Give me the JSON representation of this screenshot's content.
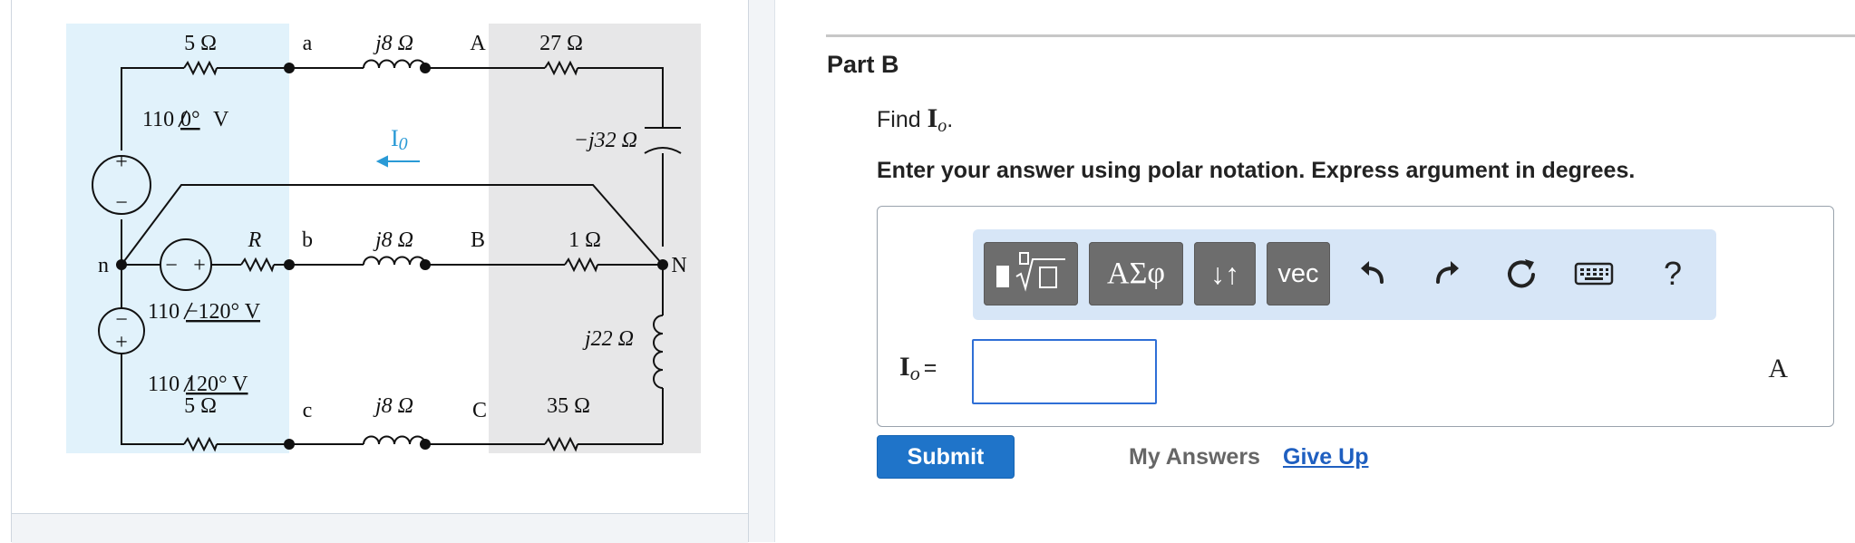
{
  "circuit": {
    "resistor_a": "5 Ω",
    "node_a": "a",
    "inductor_a": "j8 Ω",
    "node_A": "A",
    "resistor_A": "27 Ω",
    "source_a": "110",
    "source_a_angle": "0°",
    "source_a_unit": " V",
    "current_label": "I",
    "current_sub": "0",
    "capacitor": "−j32 Ω",
    "node_n": "n",
    "resistor_R": "R",
    "node_b": "b",
    "inductor_b": "j8 Ω",
    "node_B": "B",
    "resistor_B": "1 Ω",
    "node_N": "N",
    "source_b": "110",
    "source_b_angle": "−120° V",
    "inductor_N": "j22 Ω",
    "source_c": "110",
    "source_c_angle": "120° V",
    "resistor_c": "5 Ω",
    "node_c": "c",
    "inductor_c": "j8 Ω",
    "node_C": "C",
    "resistor_C": "35 Ω",
    "plus": "+",
    "minus": "−"
  },
  "part": {
    "title": "Part B",
    "find_prefix": "Find ",
    "find_symbol": "I",
    "find_sub": "o",
    "find_suffix": ".",
    "instructions": "Enter your answer using polar notation. Express argument in degrees."
  },
  "toolbar": {
    "greek_label": "ΑΣφ",
    "arrows_label": "↓↑",
    "vec_label": "vec",
    "help_label": "?"
  },
  "answer": {
    "label_symbol": "I",
    "label_sub": "o",
    "label_eq": "=",
    "value": "",
    "unit": "A"
  },
  "actions": {
    "submit": "Submit",
    "my_answers": "My Answers",
    "give_up": "Give Up"
  },
  "colors": {
    "accent": "#1f74c9",
    "link": "#1f5fc0",
    "toolbar_bg": "#d7e6f7",
    "button_gray": "#6d6d6d",
    "circuit_blue_region": "#e1f2fb",
    "circuit_gray_region": "#e7e7e8",
    "current_arrow": "#2a9ad6"
  },
  "icons": {
    "template": "fraction-root-template-icon",
    "undo": "undo-icon",
    "redo": "redo-icon",
    "reset": "reset-icon",
    "keyboard": "keyboard-icon",
    "help": "help-icon"
  }
}
